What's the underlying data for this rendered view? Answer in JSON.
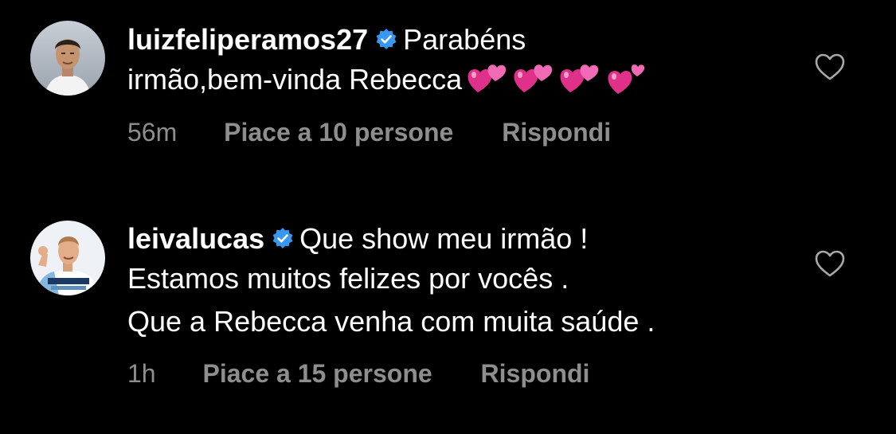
{
  "comments": [
    {
      "username": "luizfeliperamos27",
      "verified": true,
      "text_line1": "Parabéns",
      "text_line2": "irmão,bem-vinda Rebecca",
      "emoji": [
        "💞",
        "💞",
        "💞",
        "💕"
      ],
      "time": "56m",
      "likes": "Piace a 10 persone",
      "reply": "Rispondi"
    },
    {
      "username": "leivalucas",
      "verified": true,
      "text_line1": "Que show meu irmão !",
      "text_line2": "Estamos muitos felizes por vocês .",
      "text_line3": "Que a Rebecca venha com muita saúde .",
      "time": "1h",
      "likes": "Piace a 15 persone",
      "reply": "Rispondi"
    }
  ],
  "colors": {
    "background": "#000000",
    "text": "#ffffff",
    "secondary": "#8e8e8e",
    "verified": "#3897f0",
    "heart_emoji": "#e0318a"
  },
  "icons": {
    "verified": "verified-badge-icon",
    "like": "heart-outline-icon",
    "emoji": "two-hearts-emoji"
  }
}
